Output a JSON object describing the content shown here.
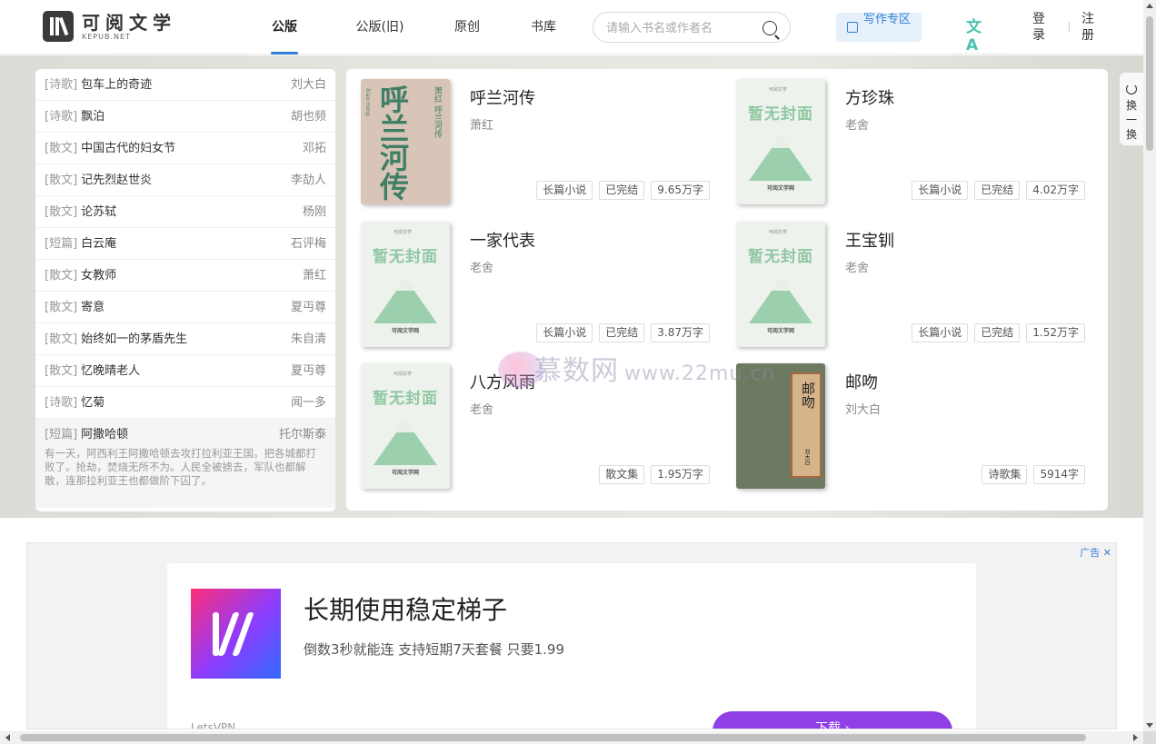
{
  "header": {
    "logo_title": "可阅文学",
    "logo_sub": "KEPUB.NET",
    "nav": [
      {
        "label": "公版",
        "active": true
      },
      {
        "label": "公版(旧)",
        "active": false
      },
      {
        "label": "原创",
        "active": false
      },
      {
        "label": "书库",
        "active": false
      }
    ],
    "search_placeholder": "请输入书名或作者名",
    "write_label": "写作专区",
    "login_label": "登录",
    "register_label": "注册",
    "translate_glyph": "文A"
  },
  "list": [
    {
      "cat": "[诗歌]",
      "title": "包车上的奇迹",
      "author": "刘大白"
    },
    {
      "cat": "[诗歌]",
      "title": "飘泊",
      "author": "胡也频"
    },
    {
      "cat": "[散文]",
      "title": "中国古代的妇女节",
      "author": "邓拓"
    },
    {
      "cat": "[散文]",
      "title": "记先烈赵世炎",
      "author": "李劼人"
    },
    {
      "cat": "[散文]",
      "title": "论苏轼",
      "author": "杨刚"
    },
    {
      "cat": "[短篇]",
      "title": "白云庵",
      "author": "石评梅"
    },
    {
      "cat": "[散文]",
      "title": "女教师",
      "author": "萧红"
    },
    {
      "cat": "[散文]",
      "title": "寄意",
      "author": "夏丏尊"
    },
    {
      "cat": "[散文]",
      "title": "始终如一的茅盾先生",
      "author": "朱自清"
    },
    {
      "cat": "[散文]",
      "title": "忆晚晴老人",
      "author": "夏丏尊"
    },
    {
      "cat": "[诗歌]",
      "title": "忆菊",
      "author": "闻一多"
    }
  ],
  "featured": {
    "cat": "[短篇]",
    "title": "阿撒哈顿",
    "author": "托尔斯泰",
    "desc": "有一天，阿西利王阿撒哈顿去攻打拉利亚王国。把各城都打败了。抢劫，焚烧无所不为。人民全被掳去，军队也都解散，连那拉利亚王也都做阶下囚了。"
  },
  "books": [
    {
      "name": "呼兰河传",
      "author": "萧红",
      "tags": [
        "长篇小说",
        "已完结",
        "9.65万字"
      ],
      "cover": "hulan"
    },
    {
      "name": "方珍珠",
      "author": "老舍",
      "tags": [
        "长篇小说",
        "已完结",
        "4.02万字"
      ],
      "cover": "placeholder"
    },
    {
      "name": "一家代表",
      "author": "老舍",
      "tags": [
        "长篇小说",
        "已完结",
        "3.87万字"
      ],
      "cover": "placeholder"
    },
    {
      "name": "王宝钏",
      "author": "老舍",
      "tags": [
        "长篇小说",
        "已完结",
        "1.52万字"
      ],
      "cover": "placeholder"
    },
    {
      "name": "八方风雨",
      "author": "老舍",
      "tags": [
        "散文集",
        "1.95万字"
      ],
      "cover": "placeholder"
    },
    {
      "name": "邮吻",
      "author": "刘大白",
      "tags": [
        "诗歌集",
        "5914字"
      ],
      "cover": "youwen"
    }
  ],
  "covers": {
    "placeholder_text": "暂无封面",
    "placeholder_brand": "可阅文学",
    "placeholder_foot": "可阅文学网",
    "hulan_big": "呼兰河传",
    "hulan_side": "萧红 呼兰河传",
    "hulan_side2": "Xiao Hong",
    "youwen_title": "邮吻",
    "youwen_author": "刘大白"
  },
  "refresh_label": "换一换",
  "watermark": {
    "text": "慕数网",
    "url": "www.22mu.cn"
  },
  "ad": {
    "mark": "广告 ✕",
    "title": "长期使用稳定梯子",
    "subtitle": "倒数3秒就能连 支持短期7天套餐 只要1.99",
    "brand": "LetsVPN",
    "button": "下载 ›"
  }
}
